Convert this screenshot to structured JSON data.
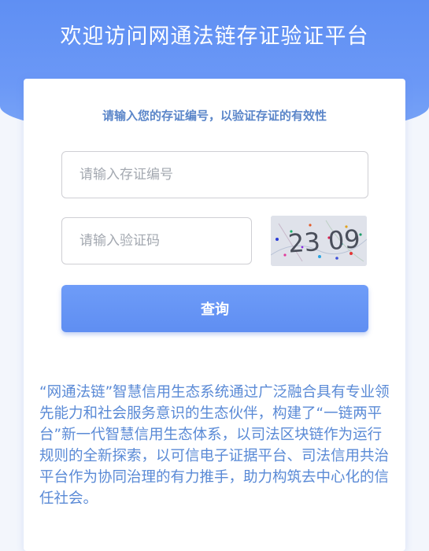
{
  "header": {
    "title": "欢迎访问网通法链存证验证平台"
  },
  "form": {
    "subtitle": "请输入您的存证编号，以验证存证的有效性",
    "code_placeholder": "请输入存证编号",
    "captcha_placeholder": "请输入验证码",
    "captcha_text": "23 09",
    "submit_label": "查询"
  },
  "description": "“网通法链”智慧信用生态系统通过广泛融合具有专业领先能力和社会服务意识的生态伙伴，构建了“一链两平台”新一代智慧信用生态体系，以司法区块链作为运行规则的全新探索，以可信电子证据平台、司法信用共治平台作为协同治理的有力推手，助力构筑去中心化的信任社会。",
  "colors": {
    "accent": "#5f8ff3",
    "text_blue": "#5a8ad6",
    "white": "#ffffff"
  }
}
